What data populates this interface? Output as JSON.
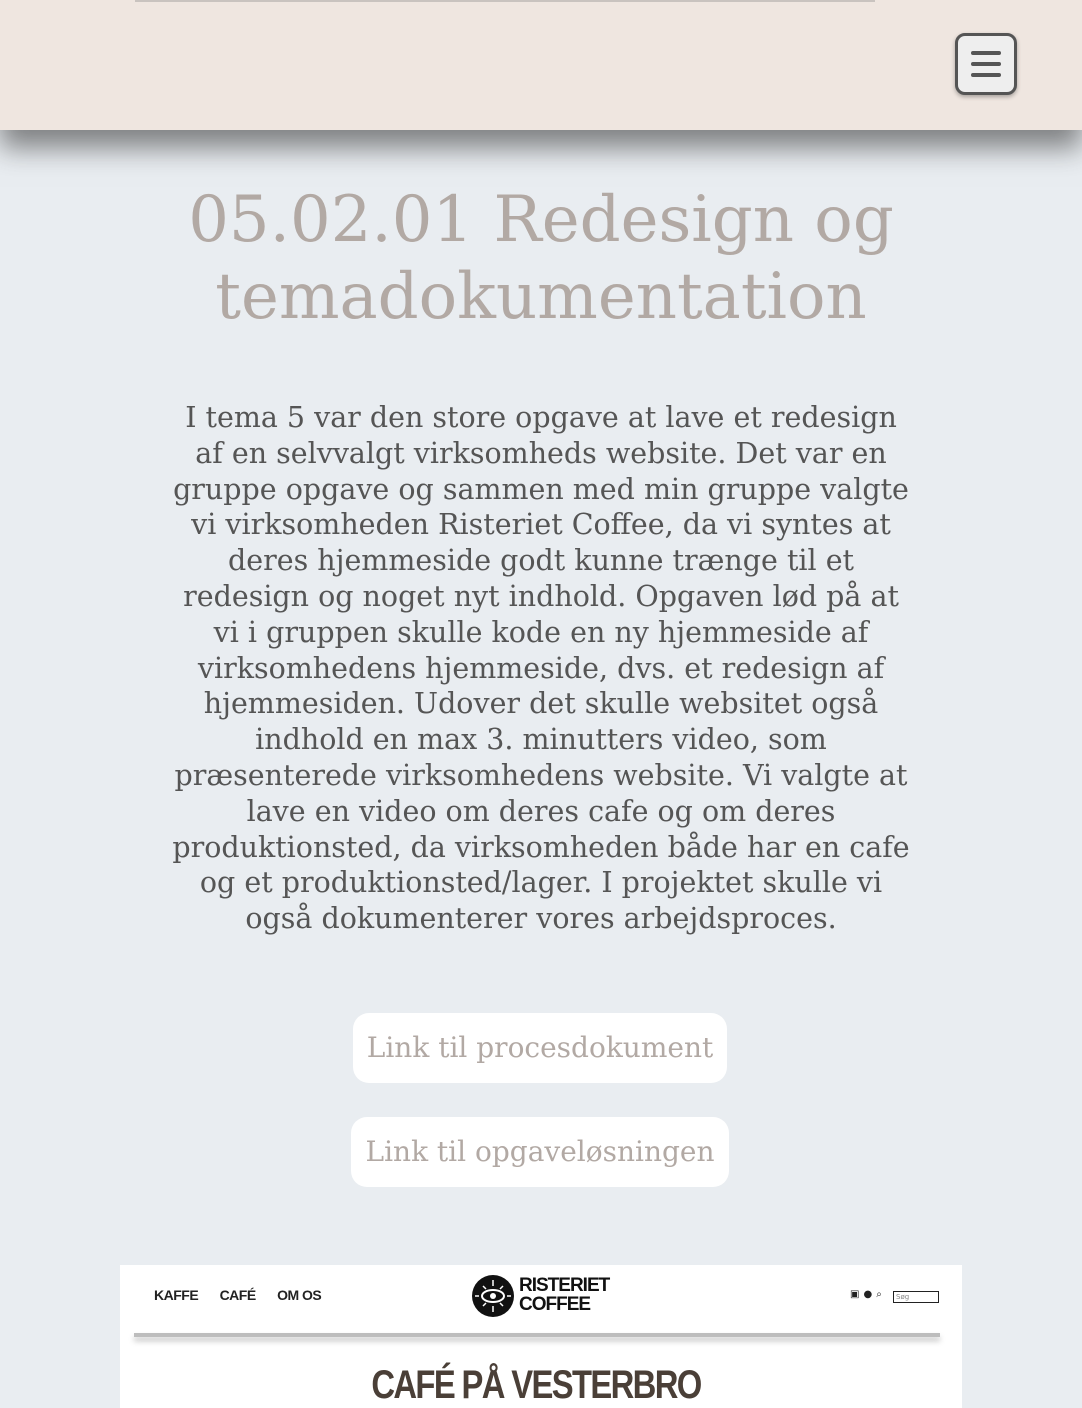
{
  "header": {
    "menu_icon": "hamburger-menu-icon"
  },
  "main": {
    "title": "05.02.01 Redesign og temadokumentation",
    "intro": "I tema 5 var den store opgave at lave et redesign af en selvvalgt virksomheds website. Det var en gruppe opgave og sammen med min gruppe valgte vi virksomheden Risteriet Coffee, da vi syntes at deres hjemmeside godt kunne trænge til et redesign og noget nyt indhold. Opgaven lød på at vi i gruppen skulle kode en ny hjemmeside af virksomhedens hjemmeside, dvs. et redesign af hjemmesiden. Udover det skulle websitet også indhold en max 3. minutters video, som præsenterede virksomhedens website. Vi valgte at lave en video om deres cafe og om deres produktionsted, da virksomheden både har en cafe og et produktionsted/lager. I projektet skulle vi også dokumenterer vores arbejdsproces.",
    "links": {
      "procesdokument": "Link til procesdokument",
      "opgaveloesning": "Link til opgaveløsningen"
    }
  },
  "preview": {
    "nav": [
      "KAFFE",
      "CAFÉ",
      "OM OS"
    ],
    "logo_line1": "RISTERIET",
    "logo_line2": "COFFEE",
    "search_placeholder": "Søg",
    "icons": [
      "basket-icon",
      "user-icon",
      "search-icon"
    ],
    "heading": "CAFÉ PÅ VESTERBRO"
  },
  "colors": {
    "header_bg": "#efe6e0",
    "page_bg": "#e9edf1",
    "title": "#b2a9a4",
    "body_text": "#555555",
    "button_bg": "#ffffff"
  }
}
